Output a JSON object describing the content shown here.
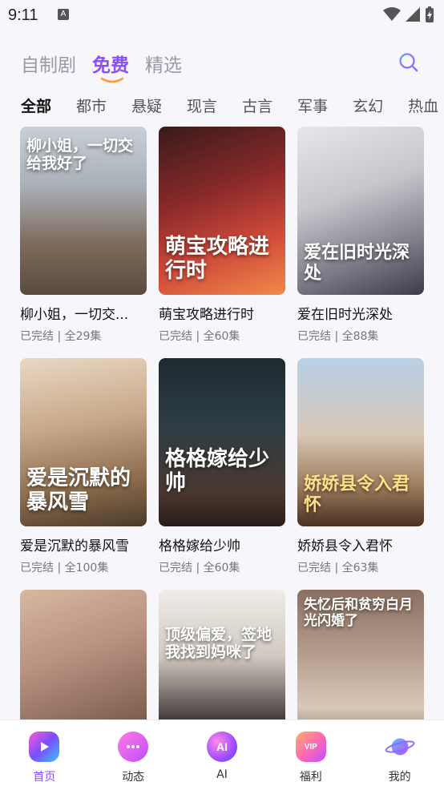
{
  "status_bar": {
    "time": "9:11",
    "notif_letter": "A"
  },
  "top_tabs": [
    {
      "label": "自制剧",
      "active": false
    },
    {
      "label": "免费",
      "active": true
    },
    {
      "label": "精选",
      "active": false
    }
  ],
  "categories": [
    {
      "label": "全部",
      "active": true
    },
    {
      "label": "都市"
    },
    {
      "label": "悬疑"
    },
    {
      "label": "现言"
    },
    {
      "label": "古言"
    },
    {
      "label": "军事"
    },
    {
      "label": "玄幻"
    },
    {
      "label": "热血"
    }
  ],
  "dramas": [
    {
      "title": "柳小姐，一切交...",
      "meta": "已完结 | 全29集",
      "poster_text": "柳小姐，一切交给我好了"
    },
    {
      "title": "萌宝攻略进行时",
      "meta": "已完结 | 全60集",
      "poster_text": "萌宝攻略进行时"
    },
    {
      "title": "爱在旧时光深处",
      "meta": "已完结 | 全88集",
      "poster_text": "爱在旧时光深处"
    },
    {
      "title": "爱是沉默的暴风雪",
      "meta": "已完结 | 全100集",
      "poster_text": "爱是沉默的暴风雪"
    },
    {
      "title": "格格嫁给少帅",
      "meta": "已完结 | 全60集",
      "poster_text": "格格嫁给少帅"
    },
    {
      "title": "娇娇县令入君怀",
      "meta": "已完结 | 全63集",
      "poster_text": "娇娇县令入君怀"
    },
    {
      "title": "",
      "meta": "",
      "poster_text": ""
    },
    {
      "title": "",
      "meta": "",
      "poster_text": "顶级偏爱，签地我找到妈咪了"
    },
    {
      "title": "",
      "meta": "",
      "poster_text": "失忆后和贫穷白月光闪婚了"
    }
  ],
  "bottom_nav": [
    {
      "label": "首页",
      "icon": "home-play-icon",
      "active": true
    },
    {
      "label": "动态",
      "icon": "chat-bubble-icon",
      "active": false
    },
    {
      "label": "AI",
      "icon": "ai-orb-icon",
      "active": false,
      "icon_text": "AI"
    },
    {
      "label": "福利",
      "icon": "gift-vip-icon",
      "active": false,
      "icon_text": "VIP"
    },
    {
      "label": "我的",
      "icon": "planet-icon",
      "active": false
    }
  ],
  "colors": {
    "accent": "#8a4dff",
    "muted": "#9a9aa8",
    "background": "#f7f6fb"
  }
}
